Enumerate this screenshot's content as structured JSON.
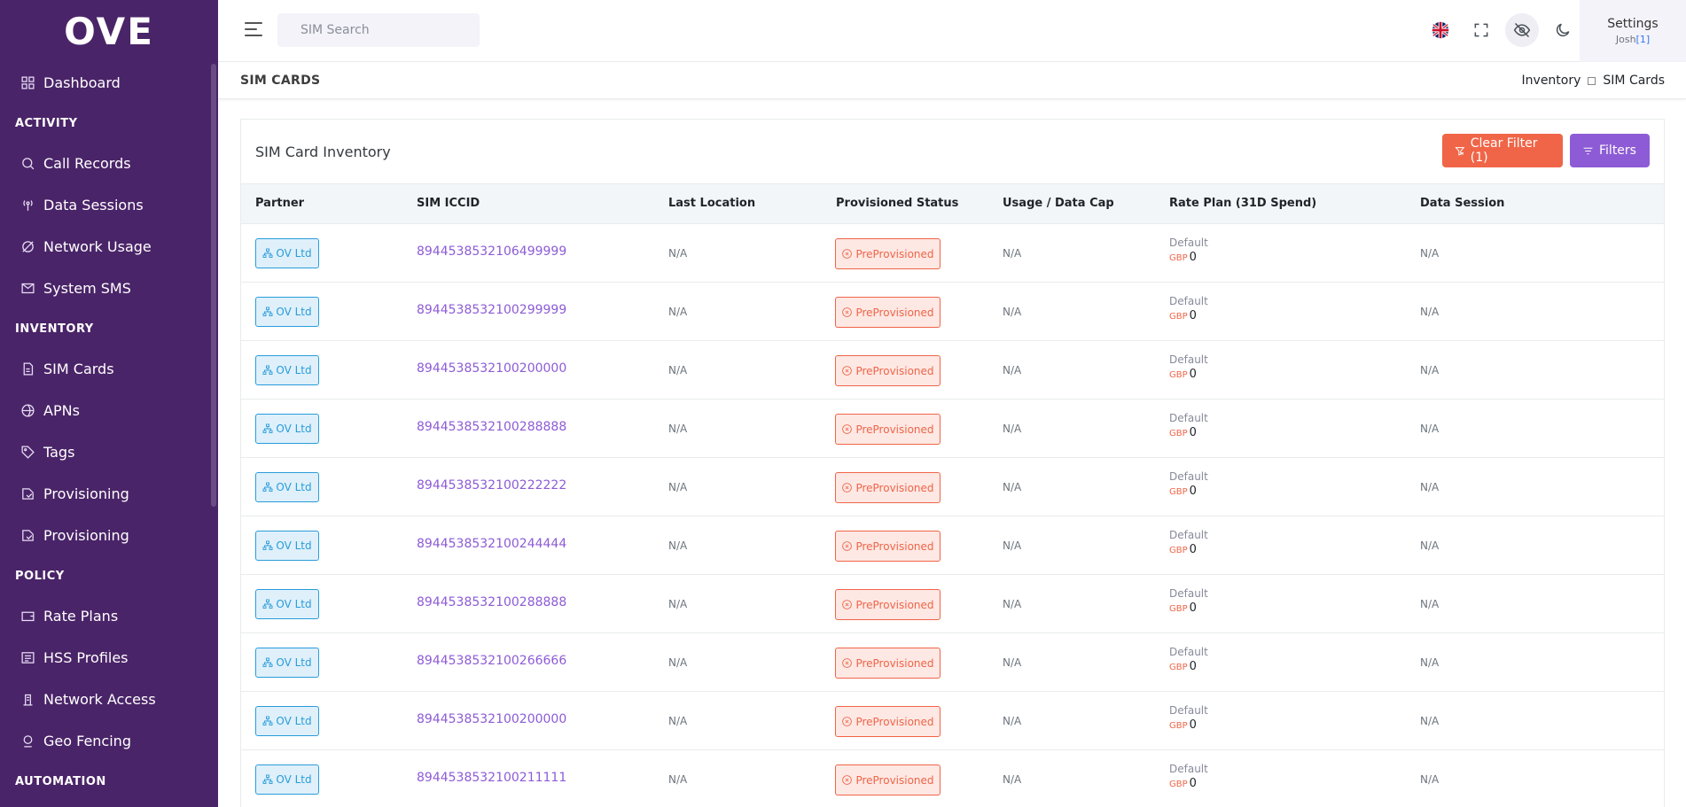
{
  "brand": {
    "logo_text": "OVE"
  },
  "sidebar": {
    "dashboard": "Dashboard",
    "sections": {
      "activity": "ACTIVITY",
      "inventory": "INVENTORY",
      "policy": "POLICY",
      "automation": "AUTOMATION"
    },
    "activity_items": [
      "Call Records",
      "Data Sessions",
      "Network Usage",
      "System SMS"
    ],
    "inventory_items": [
      "SIM Cards",
      "APNs",
      "Tags",
      "Provisioning",
      "Provisioning"
    ],
    "policy_items": [
      "Rate Plans",
      "HSS Profiles",
      "Network Access",
      "Geo Fencing"
    ]
  },
  "topbar": {
    "search_placeholder": "SIM Search",
    "settings_label": "Settings",
    "user_name": "Josh",
    "user_count": "[1]"
  },
  "page": {
    "title": "SIM CARDS",
    "breadcrumb": [
      "Inventory",
      "SIM Cards"
    ]
  },
  "card": {
    "title": "SIM Card Inventory",
    "clear_filter_label": "Clear Filter (1)",
    "filters_label": "Filters"
  },
  "table": {
    "headers": [
      "Partner",
      "SIM ICCID",
      "Last Location",
      "Provisioned Status",
      "Usage / Data Cap",
      "Rate Plan (31D Spend)",
      "Data Session"
    ],
    "rows": [
      {
        "partner": "OV Ltd",
        "iccid": "8944538532106499999",
        "last_location": "N/A",
        "status": "PreProvisioned",
        "usage": "N/A",
        "rate_plan": "Default",
        "currency": "GBP",
        "spend": "0",
        "data_session": "N/A"
      },
      {
        "partner": "OV Ltd",
        "iccid": "8944538532100299999",
        "last_location": "N/A",
        "status": "PreProvisioned",
        "usage": "N/A",
        "rate_plan": "Default",
        "currency": "GBP",
        "spend": "0",
        "data_session": "N/A"
      },
      {
        "partner": "OV Ltd",
        "iccid": "8944538532100200000",
        "last_location": "N/A",
        "status": "PreProvisioned",
        "usage": "N/A",
        "rate_plan": "Default",
        "currency": "GBP",
        "spend": "0",
        "data_session": "N/A"
      },
      {
        "partner": "OV Ltd",
        "iccid": "8944538532100288888",
        "last_location": "N/A",
        "status": "PreProvisioned",
        "usage": "N/A",
        "rate_plan": "Default",
        "currency": "GBP",
        "spend": "0",
        "data_session": "N/A"
      },
      {
        "partner": "OV Ltd",
        "iccid": "8944538532100222222",
        "last_location": "N/A",
        "status": "PreProvisioned",
        "usage": "N/A",
        "rate_plan": "Default",
        "currency": "GBP",
        "spend": "0",
        "data_session": "N/A"
      },
      {
        "partner": "OV Ltd",
        "iccid": "8944538532100244444",
        "last_location": "N/A",
        "status": "PreProvisioned",
        "usage": "N/A",
        "rate_plan": "Default",
        "currency": "GBP",
        "spend": "0",
        "data_session": "N/A"
      },
      {
        "partner": "OV Ltd",
        "iccid": "8944538532100288888",
        "last_location": "N/A",
        "status": "PreProvisioned",
        "usage": "N/A",
        "rate_plan": "Default",
        "currency": "GBP",
        "spend": "0",
        "data_session": "N/A"
      },
      {
        "partner": "OV Ltd",
        "iccid": "8944538532100266666",
        "last_location": "N/A",
        "status": "PreProvisioned",
        "usage": "N/A",
        "rate_plan": "Default",
        "currency": "GBP",
        "spend": "0",
        "data_session": "N/A"
      },
      {
        "partner": "OV Ltd",
        "iccid": "8944538532100200000",
        "last_location": "N/A",
        "status": "PreProvisioned",
        "usage": "N/A",
        "rate_plan": "Default",
        "currency": "GBP",
        "spend": "0",
        "data_session": "N/A"
      },
      {
        "partner": "OV Ltd",
        "iccid": "8944538532100211111",
        "last_location": "N/A",
        "status": "PreProvisioned",
        "usage": "N/A",
        "rate_plan": "Default",
        "currency": "GBP",
        "spend": "0",
        "data_session": "N/A"
      }
    ]
  },
  "colors": {
    "sidebar_bg": "#4a2468",
    "accent_purple": "#8d5bd6",
    "danger": "#f06548",
    "info": "#299cdb"
  }
}
